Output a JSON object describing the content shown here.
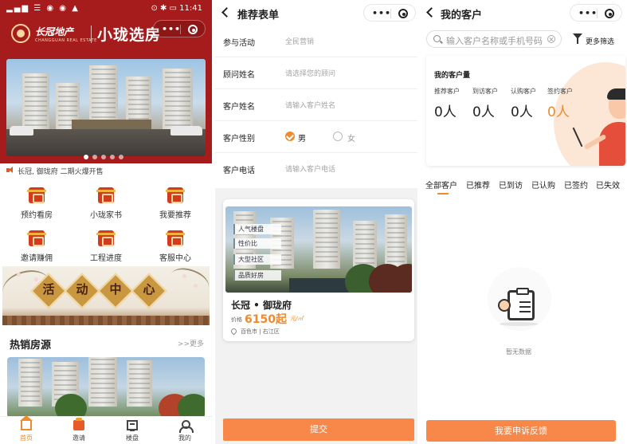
{
  "home": {
    "status_left": "▂▄▆ ☰ ◉ ◉ ▲",
    "status_right": "⊙ ✱ ▭ 11:41",
    "company_name": "长冠地产",
    "company_en": "CHANGGUAN REAL ESTATE",
    "app_title": "小珑选房",
    "notice": "长冠, 御珑府 二期火爆开售",
    "grid": [
      {
        "label": "预约看房"
      },
      {
        "label": "小珑家书"
      },
      {
        "label": "我要推荐"
      },
      {
        "label": "邀请赚佣"
      },
      {
        "label": "工程进度"
      },
      {
        "label": "客服中心"
      }
    ],
    "activity_chars": [
      "活",
      "动",
      "中",
      "心"
    ],
    "hot_title": "热销房源",
    "more": ">>更多",
    "tabs": [
      {
        "label": "首页",
        "icon": "home-icon"
      },
      {
        "label": "邀请",
        "icon": "invite-icon"
      },
      {
        "label": "楼盘",
        "icon": "building-icon"
      },
      {
        "label": "我的",
        "icon": "user-icon"
      }
    ]
  },
  "form": {
    "title": "推荐表单",
    "rows": [
      {
        "label": "参与活动",
        "value": "全民营销"
      },
      {
        "label": "顾问姓名",
        "value": "请选择您的顾问"
      },
      {
        "label": "客户姓名",
        "value": "请输入客户姓名"
      },
      {
        "label": "客户性别",
        "value": ""
      },
      {
        "label": "客户电话",
        "value": "请输入客户电话"
      }
    ],
    "gender_male": "男",
    "gender_female": "女",
    "property": {
      "tags": [
        "人气楼盘",
        "性价比",
        "大型社区",
        "品质好房"
      ],
      "name": "长冠 • 御珑府",
      "price_label": "价格",
      "price": "6150起",
      "price_unit": "元/㎡",
      "location": "百色市 | 右江区"
    },
    "submit": "提交"
  },
  "customers": {
    "title": "我的客户",
    "search_placeholder": "输入客户名称或手机号码",
    "filter": "更多筛选",
    "stats_title": "我的客户量",
    "stats": [
      {
        "label": "推荐客户",
        "value": "0人"
      },
      {
        "label": "到访客户",
        "value": "0人"
      },
      {
        "label": "认购客户",
        "value": "0人"
      },
      {
        "label": "签约客户",
        "value": "0人"
      }
    ],
    "tabs": [
      "全部客户",
      "已推荐",
      "已到访",
      "已认购",
      "已签约",
      "已失效"
    ],
    "empty": "暂无数据",
    "feedback": "我要申诉反馈"
  },
  "colors": {
    "accent": "#f08a2a",
    "brand_red": "#a61c1c",
    "button": "#f7884a"
  }
}
